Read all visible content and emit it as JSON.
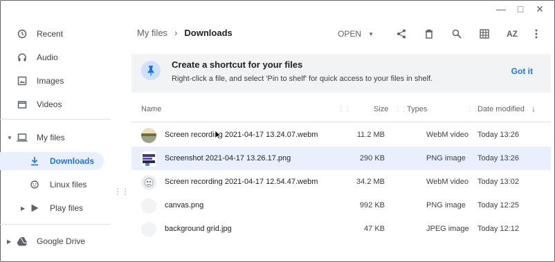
{
  "window_controls": {
    "minimize": "—",
    "maximize": "□",
    "close": "✕"
  },
  "sidebar": {
    "items": [
      {
        "label": "Recent",
        "icon": "clock-icon"
      },
      {
        "label": "Audio",
        "icon": "headphones-icon"
      },
      {
        "label": "Images",
        "icon": "image-icon"
      },
      {
        "label": "Videos",
        "icon": "video-icon"
      },
      {
        "label": "My files",
        "icon": "laptop-icon"
      },
      {
        "label": "Downloads",
        "icon": "download-icon"
      },
      {
        "label": "Linux files",
        "icon": "linux-icon"
      },
      {
        "label": "Play files",
        "icon": "play-store-icon"
      },
      {
        "label": "Google Drive",
        "icon": "google-drive-icon"
      }
    ]
  },
  "breadcrumb": {
    "root": "My files",
    "current": "Downloads"
  },
  "toolbar": {
    "open_label": "OPEN",
    "sort_label": "AZ"
  },
  "banner": {
    "title": "Create a shortcut for your files",
    "text": "Right-click a file, and select 'Pin to shelf' for quick access to your files in shelf.",
    "action": "Got it"
  },
  "table": {
    "headers": {
      "name": "Name",
      "size": "Size",
      "type": "Types",
      "date": "Date modified"
    },
    "rows": [
      {
        "name": "Screen recording 2021-04-17 13.24.07.webm",
        "size": "11.2 MB",
        "type": "WebM video",
        "date": "Today 13:26"
      },
      {
        "name": "Screenshot 2021-04-17 13.26.17.png",
        "size": "290 KB",
        "type": "PNG image",
        "date": "Today 13:26"
      },
      {
        "name": "Screen recording 2021-04-17 12.54.47.webm",
        "size": "34.2 MB",
        "type": "WebM video",
        "date": "Today 13:02"
      },
      {
        "name": "canvas.png",
        "size": "992 KB",
        "type": "PNG image",
        "date": "Today 12:25"
      },
      {
        "name": "background grid.jpg",
        "size": "47 KB",
        "type": "JPEG image",
        "date": "Today 12:12"
      }
    ]
  },
  "colors": {
    "accent": "#1a73e8",
    "selected_bg": "#e8f0fe",
    "banner_bg": "#f1f3f4"
  }
}
